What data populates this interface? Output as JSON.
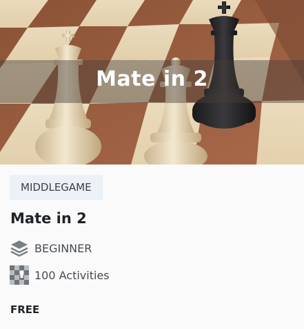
{
  "hero": {
    "title": "Mate in 2"
  },
  "course": {
    "tag": "MIDDLEGAME",
    "title": "Mate in 2",
    "level": "BEGINNER",
    "level_icon": "layers-icon",
    "activities": "100 Activities",
    "activities_icon": "chessboard-icon",
    "price": "FREE"
  },
  "colors": {
    "tag_bg": "#ebf1f6",
    "title_text": "#1f2328",
    "meta_text": "#444a50",
    "icon_gray": "#7a7f85"
  }
}
